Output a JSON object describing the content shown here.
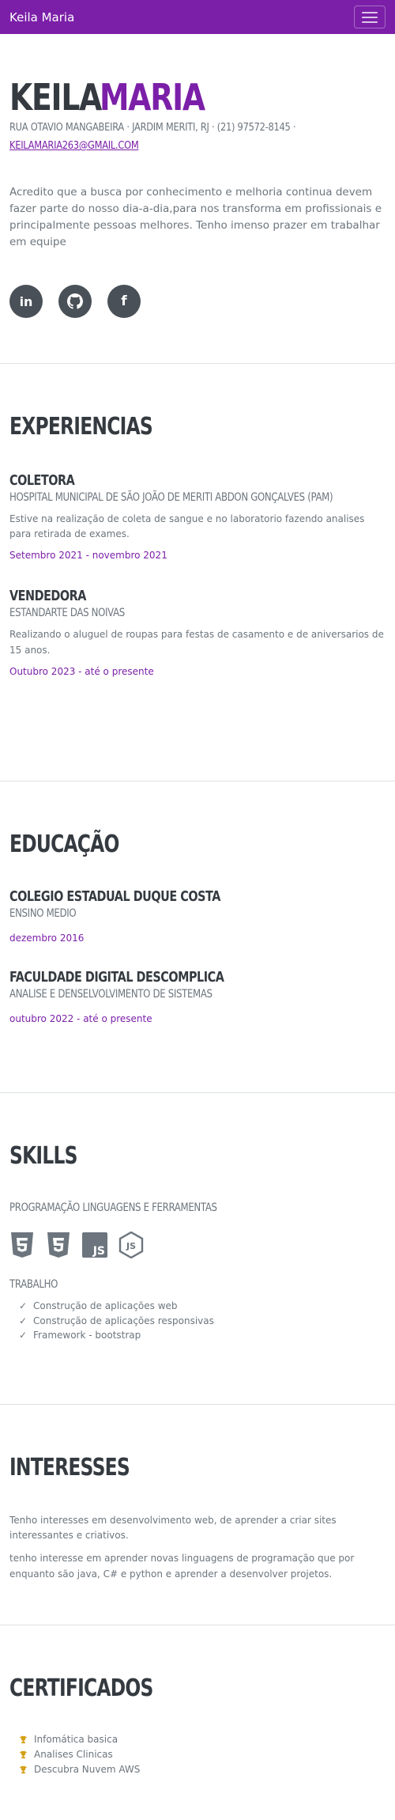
{
  "navbar": {
    "brand": "Keila Maria",
    "toggler_icon": "hamburger-icon"
  },
  "about": {
    "first_name": "KEILA",
    "last_name": "MARIA",
    "address": "RUA OTAVIO MANGABEIRA · JARDIM MERITI, RJ · (21) 97572-8145 ·",
    "email": "KEILAMARIA263@GMAIL.COM",
    "lead": "Acredito que a busca por conhecimento e melhoria continua devem fazer parte do nosso dia-a-dia,para nos transforma em profissionais e principalmente pessoas melhores. Tenho imenso prazer em trabalhar em equipe",
    "social": [
      {
        "icon": "linkedin-icon",
        "glyph": "in"
      },
      {
        "icon": "github-icon",
        "glyph": ""
      },
      {
        "icon": "facebook-icon",
        "glyph": "f"
      }
    ]
  },
  "experience": {
    "title": "EXPERIENCIAS",
    "items": [
      {
        "title": "COLETORA",
        "subtitle": "HOSPITAL MUNICIPAL DE SÃO JOÃO DE MERITI ABDON GONÇALVES (PAM)",
        "description": "Estive na realização de coleta de sangue e no laboratorio fazendo analises para retirada de exames.",
        "date": "Setembro 2021 - novembro 2021"
      },
      {
        "title": "VENDEDORA",
        "subtitle": "ESTANDARTE DAS NOIVAS",
        "description": "Realizando o aluguel de roupas para festas de casamento e de aniversarios de 15 anos.",
        "date": "Outubro 2023 - até o presente"
      }
    ]
  },
  "education": {
    "title": "EDUCAÇÃO",
    "items": [
      {
        "title": "COLEGIO ESTADUAL DUQUE COSTA",
        "subtitle": "ENSINO MEDIO",
        "date": "dezembro 2016"
      },
      {
        "title": "FACULDADE DIGITAL DESCOMPLICA",
        "subtitle": "ANALISE E DENSELVOLVIMENTO DE SISTEMAS",
        "date": "outubro 2022 - até o presente"
      }
    ]
  },
  "skills": {
    "title": "SKILLS",
    "subtitle": "PROGRAMAÇÃO LINGUAGENS E FERRAMENTAS",
    "icons": [
      "html5-icon",
      "css3-icon",
      "javascript-icon",
      "nodejs-icon"
    ],
    "work_title": "TRABALHO",
    "work_items": [
      "Construção de aplicações web",
      "Construção de aplicações responsivas",
      "Framework - bootstrap"
    ]
  },
  "interests": {
    "title": "INTERESSES",
    "paragraphs": [
      "Tenho interesses em desenvolvimento web, de aprender a criar sites interessantes e criativos.",
      "tenho interesse em aprender novas linguagens de programação que por enquanto são java, C# e python e aprender a desenvolver projetos."
    ]
  },
  "certificates": {
    "title": "CERTIFICADOS",
    "items": [
      "Infomática basica",
      "Analises Clinicas",
      "Descubra Nuvem AWS"
    ]
  },
  "colors": {
    "primary": "#7b1fa8",
    "heading": "#343a40",
    "text": "#6c757d",
    "icon_bg": "#495057",
    "trophy": "#d4a017"
  }
}
